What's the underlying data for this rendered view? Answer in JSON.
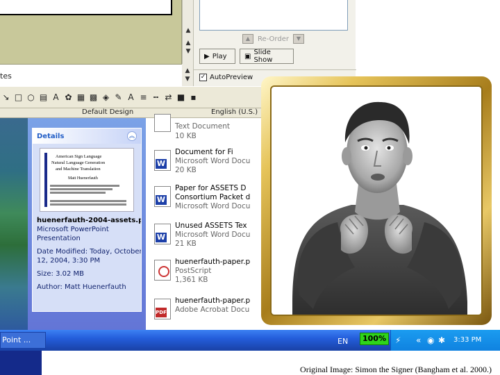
{
  "notes": {
    "text": "tes"
  },
  "task_pane": {
    "reorder_label": "Re-Order",
    "play_label": "Play",
    "slideshow_label": "Slide Show",
    "autopreview_label": "AutoPreview",
    "autopreview_checked": "✓"
  },
  "status": {
    "design": "Default Design",
    "language": "English (U.S.)"
  },
  "details": {
    "title": "Details",
    "file_name": "huenerfauth-2004-assets.p",
    "file_type_1": "Microsoft PowerPoint",
    "file_type_2": "Presentation",
    "date_modified_1": "Date Modified: Today, October",
    "date_modified_2": "12, 2004, 3:30 PM",
    "size": "Size: 3.02 MB",
    "author": "Author: Matt Huenerfauth",
    "thumbnail_lines": [
      "American Sign Language",
      "Natural Language Generation",
      "and Machine Translation",
      "Matt Huenerfauth"
    ]
  },
  "files": [
    {
      "line1": "Text Document",
      "line2": "10 KB",
      "line3": "",
      "icon": "text-document-icon"
    },
    {
      "line1": "Document for Fi",
      "line2": "Microsoft Word Docu",
      "line3": "20 KB",
      "icon": "word-document-icon"
    },
    {
      "line1": "Paper for ASSETS D",
      "line2": "Consortium Packet d",
      "line3": "Microsoft Word Docu",
      "icon": "word-document-icon"
    },
    {
      "line1": "Unused ASSETS Tex",
      "line2": "Microsoft Word Docu",
      "line3": "21 KB",
      "icon": "word-document-icon"
    },
    {
      "line1": "huenerfauth-paper.p",
      "line2": "PostScript",
      "line3": "1,361 KB",
      "icon": "postscript-icon"
    },
    {
      "line1": "huenerfauth-paper.p",
      "line2": "Adobe Acrobat Docu",
      "line3": "",
      "icon": "pdf-icon"
    }
  ],
  "taskbar": {
    "task_button": "Point ...",
    "language": "EN",
    "zoom": "100%",
    "clock": "3:33 PM"
  },
  "caption": "Original Image: Simon the Signer (Bangham et al. 2000.)"
}
